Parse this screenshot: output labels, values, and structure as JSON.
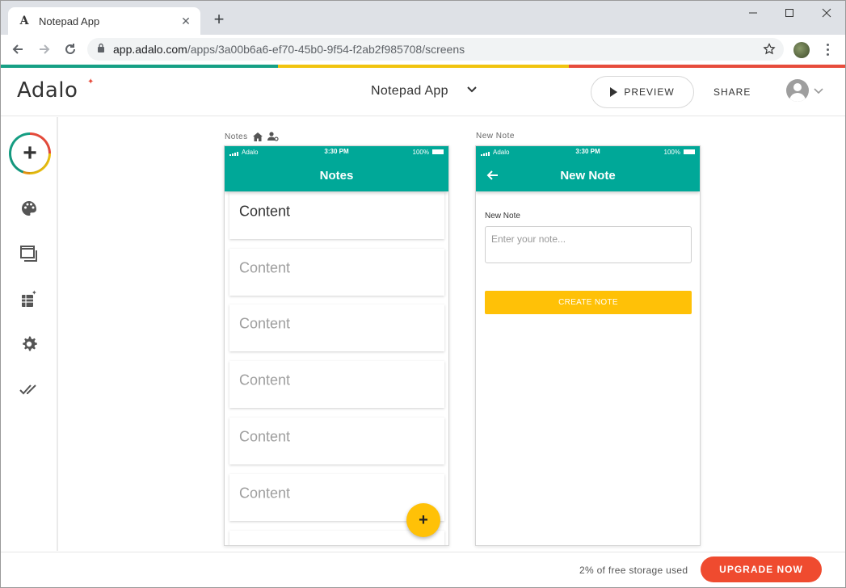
{
  "browser": {
    "tab_title": "Notepad App",
    "new_tab": "+",
    "tab_close": "✕",
    "url_host": "app.adalo.com",
    "url_path": "/apps/3a00b6a6-ef70-45b0-9f54-f2ab2f985708/screens"
  },
  "header": {
    "logo": "Adalo",
    "app_name": "Notepad App",
    "preview_label": "PREVIEW",
    "share_label": "SHARE"
  },
  "sidebar": {
    "add": "+",
    "items": [
      "add-component",
      "branding",
      "screens",
      "database",
      "settings",
      "publish"
    ]
  },
  "screens": [
    {
      "label": "Notes",
      "status": {
        "carrier": "Adalo",
        "time": "3:30 PM",
        "battery": "100%"
      },
      "title": "Notes",
      "cards": [
        "Content",
        "Content",
        "Content",
        "Content",
        "Content",
        "Content"
      ],
      "fab": "+"
    },
    {
      "label": "New Note",
      "status": {
        "carrier": "Adalo",
        "time": "3:30 PM",
        "battery": "100%"
      },
      "title": "New Note",
      "field_label": "New Note",
      "input_placeholder": "Enter your note...",
      "button_label": "CREATE NOTE"
    }
  ],
  "footer": {
    "storage_text": "2% of free storage used",
    "upgrade_label": "UPGRADE NOW"
  },
  "colors": {
    "teal": "#00a898",
    "yellow": "#ffc107",
    "upgrade": "#ef4b2f",
    "strip": [
      "#16a085",
      "#f1c40f",
      "#e74c3c"
    ]
  }
}
